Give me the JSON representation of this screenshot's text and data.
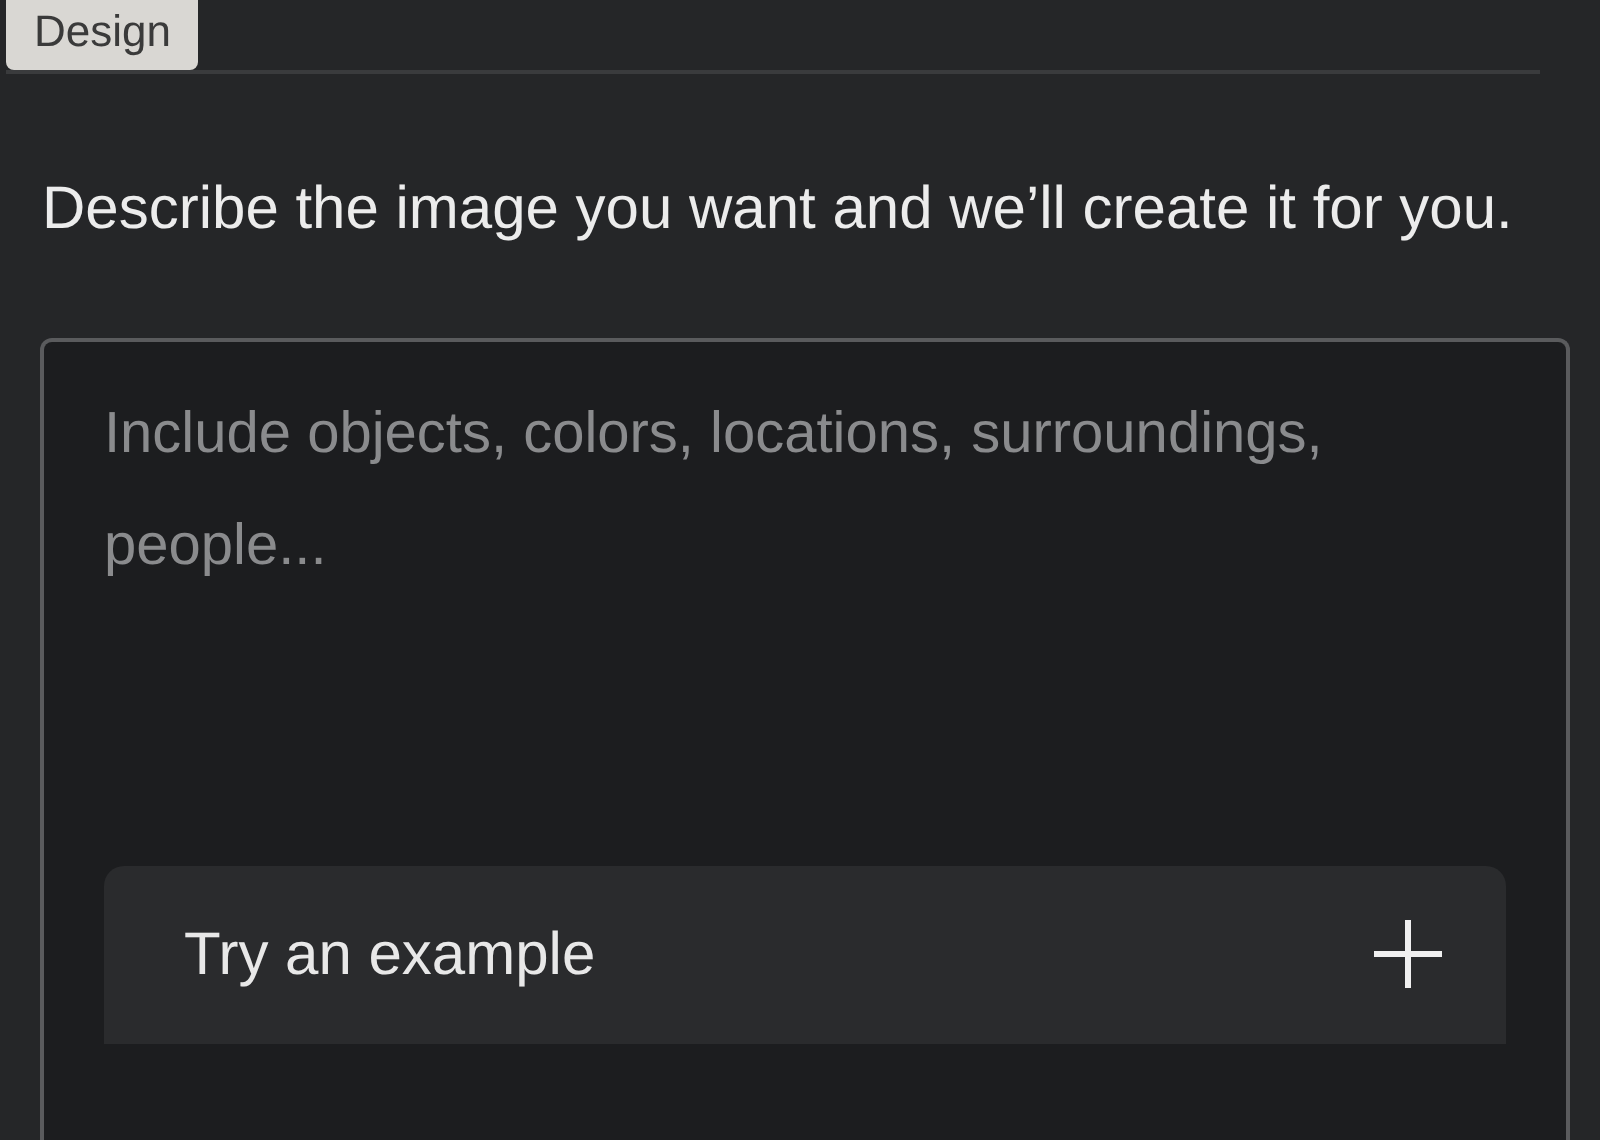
{
  "tabs": [
    {
      "label": "Design",
      "selected": true
    }
  ],
  "description": "Describe the image you want and we’ll create it for you.",
  "prompt": {
    "placeholder": "Include objects, colors, locations, surroundings, people..."
  },
  "example_button": {
    "label": "Try an example"
  }
}
